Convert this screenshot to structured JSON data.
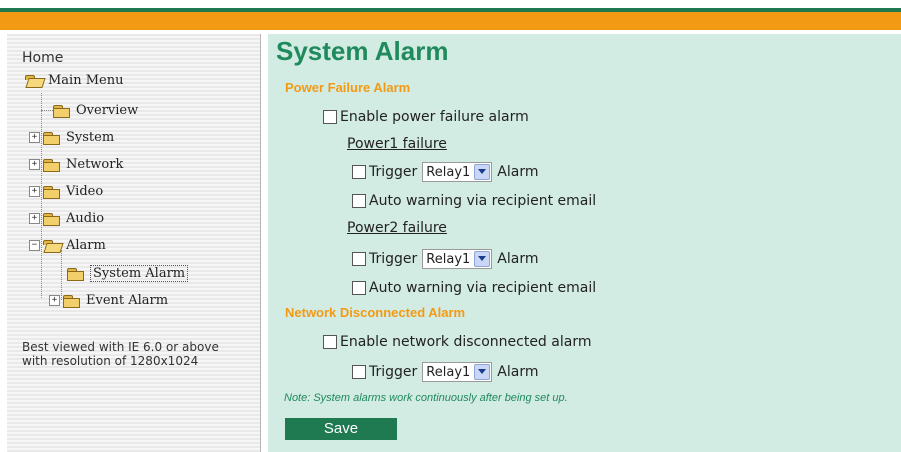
{
  "sidebar": {
    "home": "Home",
    "main_menu": "Main Menu",
    "items": [
      "Overview",
      "System",
      "Network",
      "Video",
      "Audio",
      "Alarm"
    ],
    "alarm_children": [
      "System Alarm",
      "Event Alarm"
    ],
    "best_viewed": "Best viewed with IE 6.0 or above with resolution of 1280x1024"
  },
  "main": {
    "title": "System Alarm",
    "power_failure_section": "Power Failure Alarm",
    "enable_power_failure": "Enable power failure alarm",
    "power1_failure": "Power1 failure",
    "power2_failure": "Power2 failure",
    "trigger": "Trigger",
    "relay_value": "Relay1",
    "alarm": "Alarm",
    "auto_warning": "Auto warning via recipient email",
    "network_section": "Network Disconnected Alarm",
    "enable_network": "Enable network disconnected alarm",
    "note": "Note: System alarms work continuously after being set up.",
    "save": "Save"
  },
  "colors": {
    "accent_green": "#1f7a52",
    "accent_orange": "#f39a14",
    "content_bg": "#d2ebe3"
  }
}
